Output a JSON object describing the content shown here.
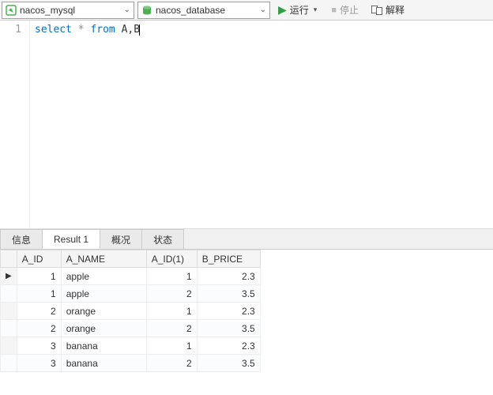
{
  "toolbar": {
    "connection": "nacos_mysql",
    "database": "nacos_database",
    "run_label": "运行",
    "stop_label": "停止",
    "explain_label": "解释"
  },
  "editor": {
    "line_num": "1",
    "kw_select": "select",
    "star": " * ",
    "kw_from": "from",
    "tables": " A,B"
  },
  "tabs": {
    "t0": "信息",
    "t1": "Result 1",
    "t2": "概况",
    "t3": "状态"
  },
  "columns": {
    "c0": "A_ID",
    "c1": "A_NAME",
    "c2": "A_ID(1)",
    "c3": "B_PRICE"
  },
  "rows": [
    {
      "a_id": "1",
      "a_name": "apple",
      "a_id1": "1",
      "b_price": "2.3"
    },
    {
      "a_id": "1",
      "a_name": "apple",
      "a_id1": "2",
      "b_price": "3.5"
    },
    {
      "a_id": "2",
      "a_name": "orange",
      "a_id1": "1",
      "b_price": "2.3"
    },
    {
      "a_id": "2",
      "a_name": "orange",
      "a_id1": "2",
      "b_price": "3.5"
    },
    {
      "a_id": "3",
      "a_name": "banana",
      "a_id1": "1",
      "b_price": "2.3"
    },
    {
      "a_id": "3",
      "a_name": "banana",
      "a_id1": "2",
      "b_price": "3.5"
    }
  ]
}
